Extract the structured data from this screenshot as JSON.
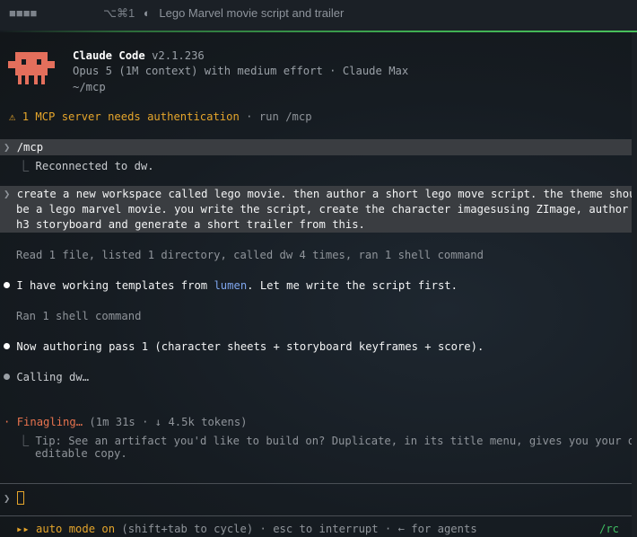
{
  "titlebar": {
    "tab_indicator": "■■■■",
    "shortcut": "⌥⌘1",
    "spinner": "◐",
    "title": "Lego Marvel movie script and trailer"
  },
  "header": {
    "app_name": "Claude Code",
    "version": "v2.1.236",
    "model_line": "Opus 5 (1M context) with medium effort · Claude Max",
    "cwd": "~/mcp"
  },
  "notice": {
    "icon": "⚠",
    "text": "1 MCP server needs authentication",
    "hint": " · run /mcp"
  },
  "log": {
    "cmd_prompt": "❯",
    "cmd": "/mcp",
    "cmd_result_prefix": "⎿",
    "cmd_result": "Reconnected to dw.",
    "user_prompt": "❯",
    "user_msg_1": "create a new workspace called lego movie. then author a short lego move script. the theme should",
    "user_msg_2": "be a lego marvel movie. you write the script, create the character imagesusing ZImage, author an",
    "user_msg_3": "h3 storyboard and generate a short trailer from this.",
    "tool_summary_1": "Read 1 file, listed 1 directory, called dw 4 times, ran 1 shell command",
    "assistant_1_pre": "I have working templates from ",
    "assistant_1_link": "lumen",
    "assistant_1_post": ". Let me write the script first.",
    "tool_summary_2": "Ran 1 shell command",
    "assistant_2": "Now authoring pass 1 (character sheets + storyboard keyframes + score).",
    "calling": "Calling dw…",
    "status_glyph": "·",
    "status_label": "Finagling…",
    "status_meta": " (1m 31s · ↓ 4.5k tokens)",
    "tip_prefix": "⎿",
    "tip_line_1": "Tip: See an artifact you'd like to build on? Duplicate, in its title menu, gives you your own",
    "tip_line_2": "editable copy."
  },
  "input": {
    "prompt": "❯",
    "value": ""
  },
  "footer": {
    "mode_icon": "▸▸",
    "mode_label": "auto mode on",
    "mode_hint": " (shift+tab to cycle) · esc to interrupt · ← for agents",
    "right_label": "/rc"
  },
  "colors": {
    "accent_warn": "#e5a52b",
    "status_red": "#e8734e",
    "link_blue": "#7fa6ee",
    "rc_green": "#3fbf62",
    "mascot": "#e46f5c"
  }
}
